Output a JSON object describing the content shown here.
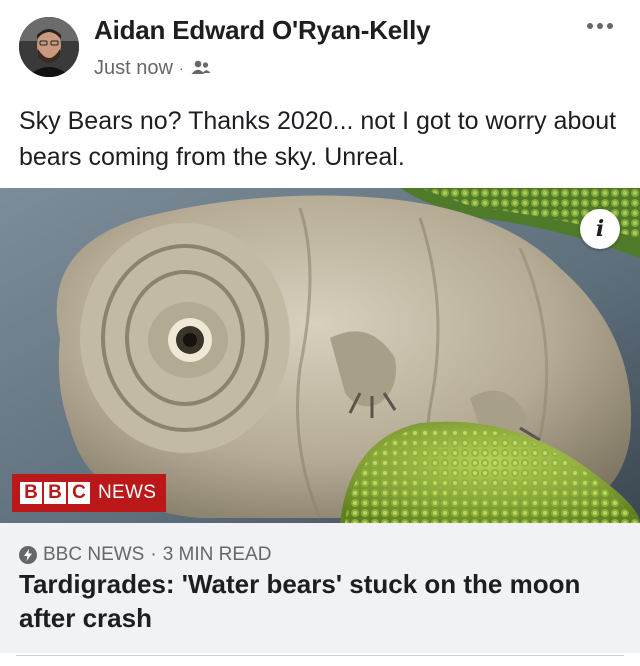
{
  "post": {
    "author_name": "Aidan Edward O'Ryan-Kelly",
    "timestamp": "Just now",
    "separator": "·",
    "audience_icon": "friends-icon",
    "more_icon": "more-options-icon",
    "text": "Sky Bears no? Thanks 2020... not I got to worry about bears coming from the sky. Unreal."
  },
  "link_preview": {
    "image_subject": "tardigrade",
    "info_label": "i",
    "logo": {
      "letters": [
        "B",
        "B",
        "C"
      ],
      "word": "NEWS",
      "color": "#bb1919"
    },
    "source_icon": "bolt-icon",
    "source": "BBC NEWS",
    "separator": "·",
    "read_time": "3 MIN READ",
    "title": "Tardigrades: 'Water bears' stuck on the moon after crash"
  },
  "colors": {
    "text_primary": "#1c1e21",
    "text_secondary": "#65676b",
    "footer_bg": "#f0f2f5",
    "bbc_red": "#bb1919"
  }
}
